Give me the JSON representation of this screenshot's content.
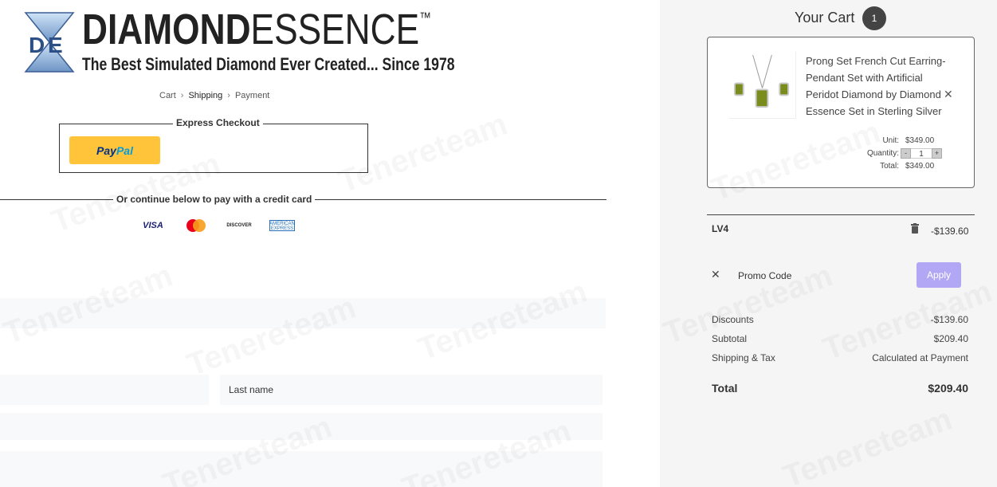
{
  "brand": {
    "word_bold": "DIAMOND",
    "word_thin": "ESSENCE",
    "tm": "™",
    "tagline": "The Best Simulated Diamond Ever Created... Since 1978",
    "mark_letters": "DE"
  },
  "breadcrumb": {
    "items": [
      "Cart",
      "Shipping",
      "Payment"
    ],
    "separator": "›"
  },
  "express_checkout": {
    "legend": "Express Checkout",
    "paypal_part1": "Pay",
    "paypal_part2": "Pal"
  },
  "divider_text": "Or continue below to pay with a credit card",
  "cards": {
    "visa": "VISA",
    "discover": "DISCOVER",
    "amex": "AMERICAN EXPRESS"
  },
  "form": {
    "last_name_placeholder": "Last name"
  },
  "cart": {
    "title": "Your Cart",
    "count": "1",
    "item": {
      "name": "Prong Set French Cut Earring-Pendant Set with Artificial Peridot Diamond by Diamond Essence Set in Sterling Silver",
      "unit_label": "Unit:",
      "unit_value": "$349.00",
      "quantity_label": "Quantity:",
      "quantity": "1",
      "minus": "-",
      "plus": "+",
      "total_label": "Total:",
      "total_value": "$349.00",
      "remove": "✕"
    },
    "coupon": {
      "code": "LV4",
      "amount": "-$139.60"
    },
    "promo": {
      "clear": "✕",
      "placeholder": "Promo Code",
      "apply": "Apply"
    },
    "summary": {
      "discounts_label": "Discounts",
      "discounts_value": "-$139.60",
      "subtotal_label": "Subtotal",
      "subtotal_value": "$209.40",
      "shipping_label": "Shipping & Tax",
      "shipping_value": "Calculated at Payment",
      "total_label": "Total",
      "total_value": "$209.40"
    }
  },
  "colors": {
    "paypal_yellow": "#ffc439",
    "apply_purple": "#b2a7f5",
    "cart_bg": "#f5f5f5",
    "peridot": "#7a8c1c"
  }
}
